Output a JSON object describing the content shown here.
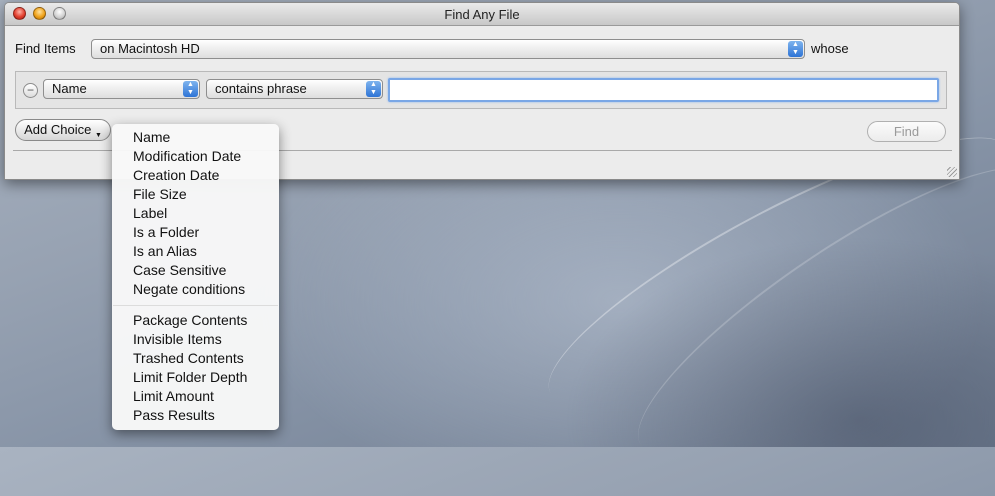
{
  "window": {
    "title": "Find Any File"
  },
  "search": {
    "find_items_label": "Find Items",
    "location_value": "on Macintosh HD",
    "whose_label": "whose"
  },
  "rule": {
    "attribute_value": "Name",
    "operator_value": "contains phrase",
    "query_value": ""
  },
  "buttons": {
    "add_choice": "Add Choice",
    "find": "Find"
  },
  "menu": {
    "group1": [
      "Name",
      "Modification Date",
      "Creation Date",
      "File Size",
      "Label",
      "Is a Folder",
      "Is an Alias",
      "Case Sensitive",
      "Negate conditions"
    ],
    "group2": [
      "Package Contents",
      "Invisible Items",
      "Trashed Contents",
      "Limit Folder Depth",
      "Limit Amount",
      "Pass Results"
    ]
  },
  "icons": {
    "close": "close-icon",
    "minimize": "minimize-icon",
    "zoom": "zoom-icon",
    "popup_arrows": "updown-arrows-icon",
    "remove_rule": "minus-circle-icon",
    "resize": "resize-grip-icon",
    "dropdown": "triangle-down-icon"
  },
  "colors": {
    "accent": "#2e74d6",
    "focus_ring": "#7aa7e6"
  }
}
